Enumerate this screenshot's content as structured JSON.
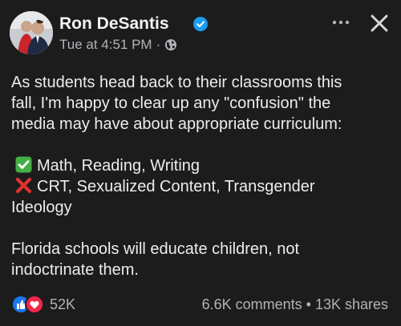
{
  "post": {
    "author": "Ron DeSantis",
    "timestamp": "Tue at 4:51 PM",
    "meta_separator": "·",
    "paragraphs": {
      "intro": {
        "line1": "As students head back to their classrooms this",
        "line2": "fall, I'm happy to clear up any \"confusion\" the",
        "line3": "media may have about appropriate curriculum:"
      },
      "approved": "Math, Reading, Writing",
      "rejected_line1": "CRT, Sexualized Content, Transgender",
      "rejected_line2": "Ideology",
      "closing": {
        "line1": "Florida schools will educate children, not",
        "line2": "indoctrinate them."
      }
    }
  },
  "footer": {
    "reactions_count": "52K",
    "comments": "6.6K comments",
    "separator": "•",
    "shares": "13K shares"
  },
  "icons": {
    "verified": "verified-badge-icon",
    "audience": "globe-icon",
    "approved": "check-mark-emoji-icon",
    "rejected": "cross-mark-emoji-icon",
    "more": "more-options-icon",
    "close": "close-icon",
    "reactions": [
      "like-reaction-icon",
      "love-reaction-icon"
    ]
  },
  "colors": {
    "background": "#1c1c1d",
    "verified": "#1d9bf0",
    "check_green": "#43b047",
    "cross_red": "#e1312d",
    "like_blue": "#1877f2",
    "love_red": "#f02849"
  }
}
